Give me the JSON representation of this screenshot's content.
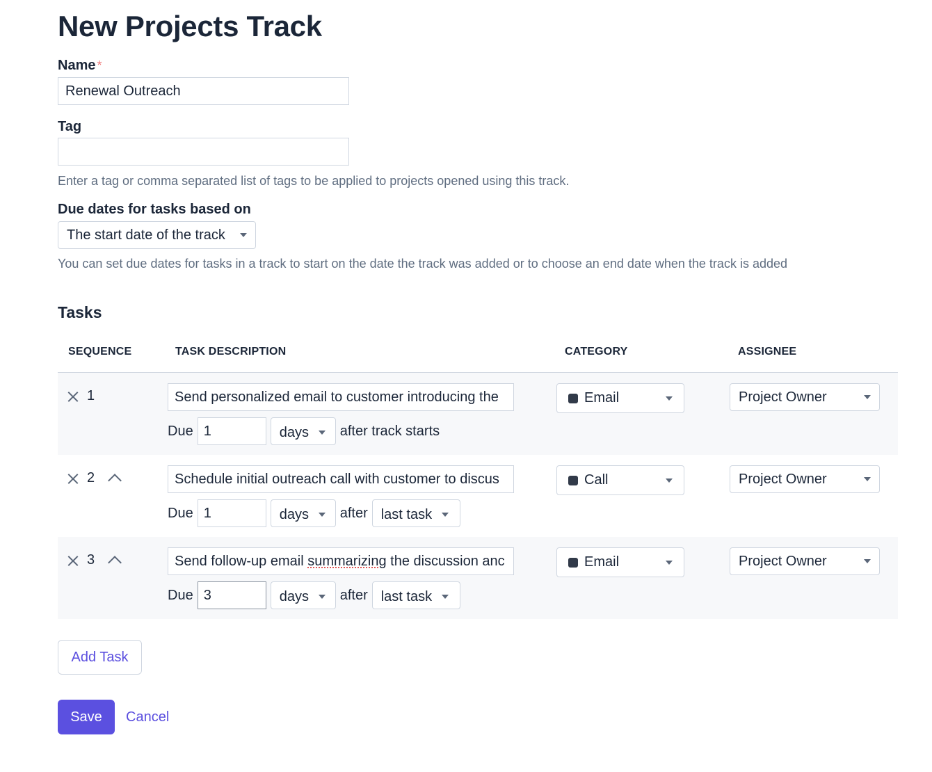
{
  "page": {
    "title": "New Projects Track"
  },
  "form": {
    "name": {
      "label": "Name",
      "required_mark": "*",
      "value": "Renewal Outreach"
    },
    "tag": {
      "label": "Tag",
      "value": "",
      "help": "Enter a tag or comma separated list of tags to be applied to projects opened using this track."
    },
    "due_basis": {
      "label": "Due dates for tasks based on",
      "selected": "The start date of the track",
      "help": "You can set due dates for tasks in a track to start on the date the track was added or to choose an end date when the track is added"
    }
  },
  "tasks": {
    "title": "Tasks",
    "columns": {
      "sequence": "SEQUENCE",
      "description": "TASK DESCRIPTION",
      "category": "CATEGORY",
      "assignee": "ASSIGNEE"
    },
    "rows": [
      {
        "sequence": "1",
        "description": "Send personalized email to customer introducing the",
        "due_label": "Due",
        "due_value": "1",
        "unit": "days",
        "after_text": "after track starts",
        "category": "Email",
        "assignee": "Project Owner"
      },
      {
        "sequence": "2",
        "description": "Schedule initial outreach call with customer to discus",
        "due_label": "Due",
        "due_value": "1",
        "unit": "days",
        "after_text": "after",
        "relative_to": "last task",
        "category": "Call",
        "assignee": "Project Owner"
      },
      {
        "sequence": "3",
        "description_pre": "Send follow-up email ",
        "description_flagged": "summarizing",
        "description_post": " the discussion anc",
        "due_label": "Due",
        "due_value": "3",
        "unit": "days",
        "after_text": "after",
        "relative_to": "last task",
        "category": "Email",
        "assignee": "Project Owner"
      }
    ]
  },
  "actions": {
    "add_task": "Add Task",
    "save": "Save",
    "cancel": "Cancel"
  },
  "colors": {
    "accent": "#5b50e0",
    "text": "#1b2638",
    "muted": "#5f6d80",
    "required": "#f07e7e",
    "row_shade": "#f7f8fa"
  }
}
